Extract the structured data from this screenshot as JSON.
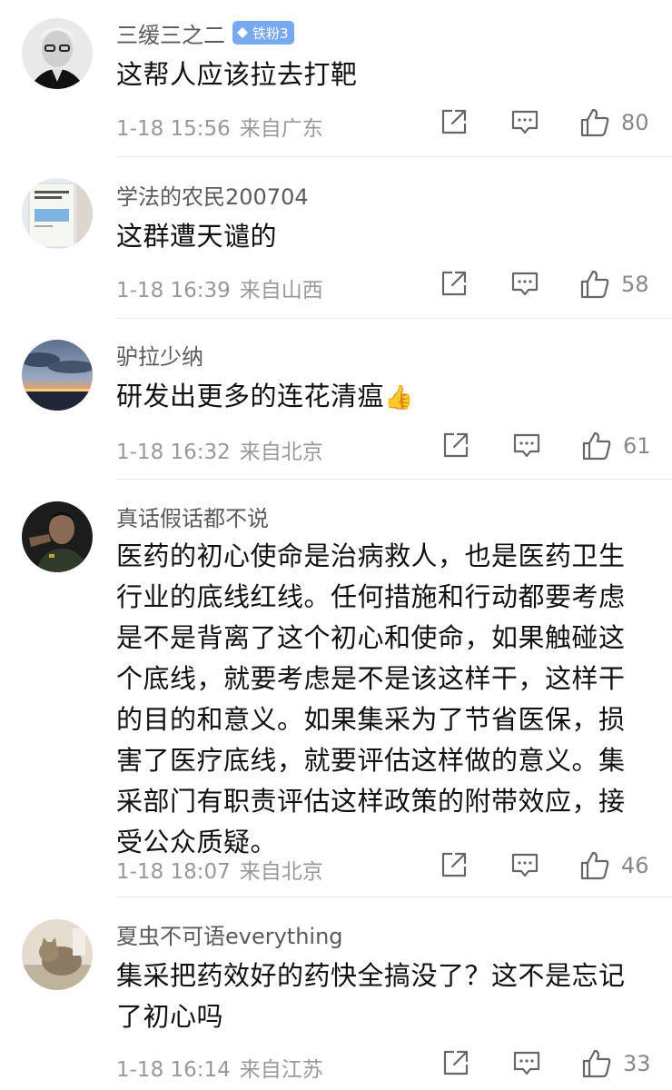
{
  "comments": [
    {
      "username": "三缓三之二",
      "badge": "铁粉3",
      "text": "这帮人应该拉去打靶",
      "time": "1-18 15:56",
      "location": "来自广东",
      "likes": "80",
      "avatar": "man-glasses-bw"
    },
    {
      "username": "学法的农民200704",
      "text": "这群遭天谴的",
      "time": "1-18 16:39",
      "location": "来自山西",
      "likes": "58",
      "avatar": "book-cover"
    },
    {
      "username": "驴拉少纳",
      "text": "研发出更多的连花清瘟",
      "emoji": "👍",
      "time": "1-18 16:32",
      "location": "来自北京",
      "likes": "61",
      "avatar": "sunset-sky"
    },
    {
      "username": "真话假话都不说",
      "text_lines": [
        "医药的初心使命是治病救人，也是医药卫生",
        "行业的底线红线。任何措施和行动都要考虑",
        "是不是背离了这个初心和使命，如果触碰这",
        "个底线，就要考虑是不是该这样干，这样干",
        "的目的和意义。如果集采为了节省医保，损",
        "害了医疗底线，就要评估这样做的意义。集",
        "采部门有职责评估这样政策的附带效应，接",
        "受公众质疑。"
      ],
      "time": "1-18 18:07",
      "location": "来自北京",
      "likes": "46",
      "avatar": "man-uniform"
    },
    {
      "username": "夏虫不可语everything",
      "text_lines": [
        "集采把药效好的药快全搞没了？这不是忘记",
        "了初心吗"
      ],
      "time": "1-18 16:14",
      "location": "来自江苏",
      "likes": "33",
      "avatar": "cat-photo"
    }
  ],
  "icons": {
    "share": "share-icon",
    "reply": "comment-icon",
    "like": "thumbs-up-icon"
  },
  "colors": {
    "badge": "#78a8f0",
    "meta": "#999999",
    "username": "#5a5a5a"
  }
}
